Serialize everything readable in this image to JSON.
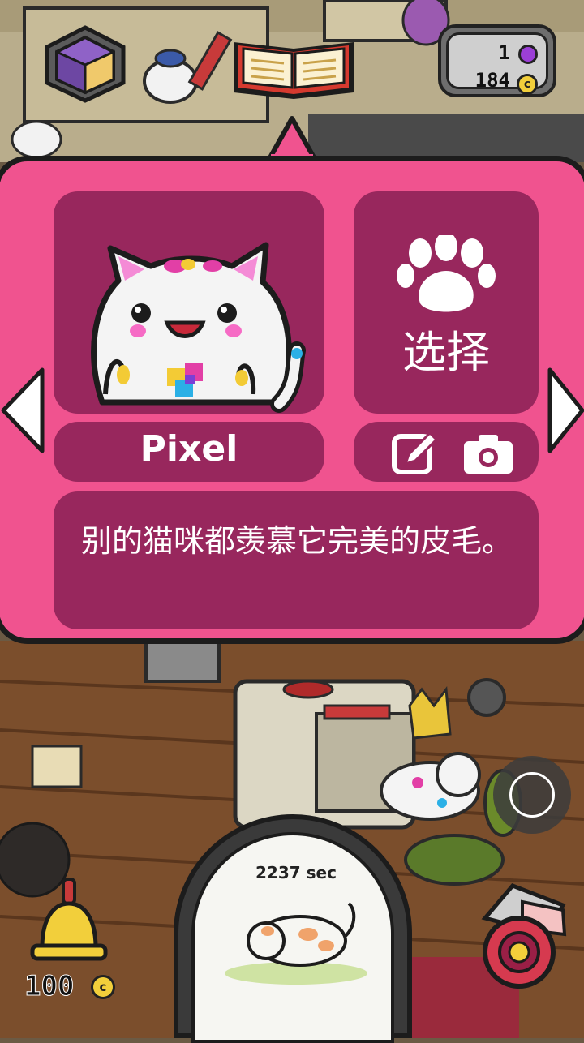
{
  "hud": {
    "gem_count": "1",
    "coin_count": "184",
    "coin_symbol": "c"
  },
  "cat_card": {
    "name": "Pixel",
    "select_label": "选择",
    "description": "别的猫咪都羡慕它完美的皮毛。"
  },
  "feeder": {
    "timer": "2237 sec"
  },
  "bell": {
    "price": "100",
    "coin_symbol": "c"
  },
  "colors": {
    "panel_pink": "#f0538f",
    "tile_maroon": "#98275d",
    "outline": "#1c1c1c"
  }
}
